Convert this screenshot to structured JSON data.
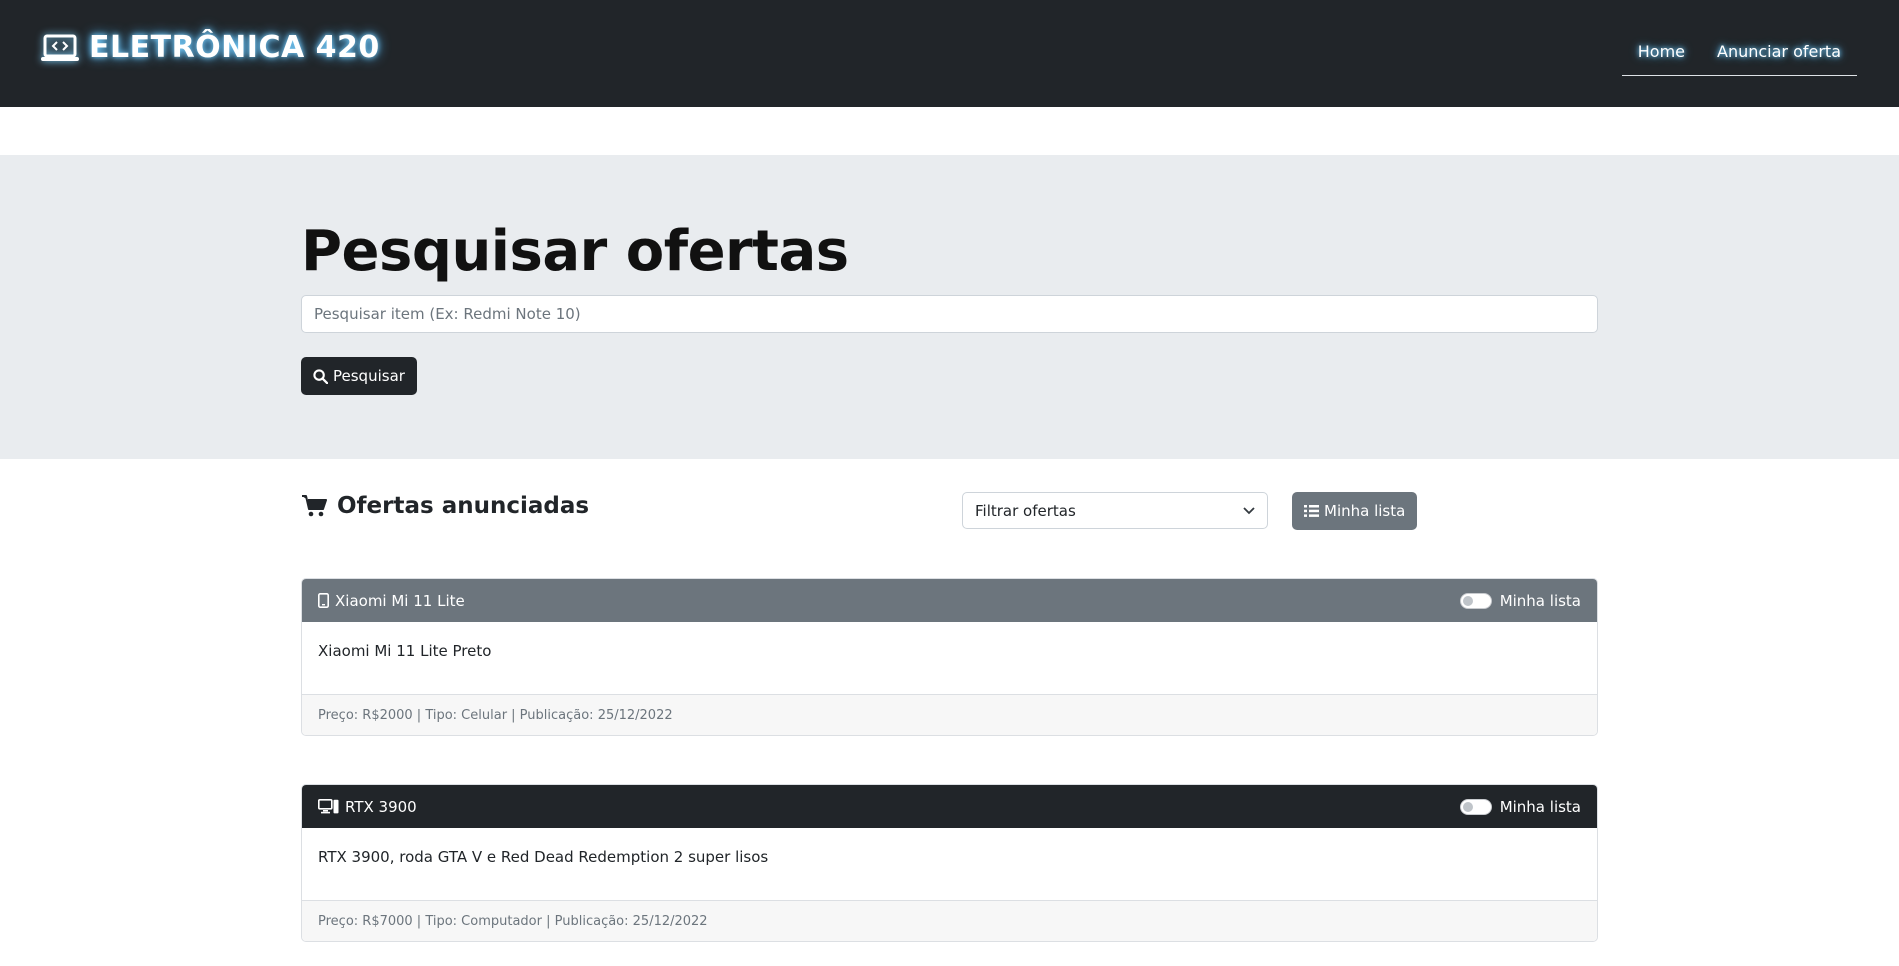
{
  "navbar": {
    "brand": "ELETRÔNICA 420",
    "links": [
      "Home",
      "Anunciar oferta"
    ]
  },
  "hero": {
    "title": "Pesquisar ofertas",
    "search_placeholder": "Pesquisar item (Ex: Redmi Note 10)",
    "search_button": "Pesquisar"
  },
  "offers": {
    "title": "Ofertas anunciadas",
    "filter_label": "Filtrar ofertas",
    "list_button": "Minha lista",
    "cards": [
      {
        "name": "Xiaomi Mi 11 Lite",
        "icon": "mobile-icon",
        "header_color": "#6c757d",
        "toggle_label": "Minha lista",
        "description": "Xiaomi Mi 11 Lite Preto",
        "footer": "Preço: R$2000 | Tipo: Celular | Publicação: 25/12/2022"
      },
      {
        "name": "RTX 3900",
        "icon": "desktop-icon",
        "header_color": "#212529",
        "toggle_label": "Minha lista",
        "description": "RTX 3900, roda GTA V e Red Dead Redemption 2 super lisos",
        "footer": "Preço: R$7000 | Tipo: Computador | Publicação: 25/12/2022"
      }
    ]
  }
}
